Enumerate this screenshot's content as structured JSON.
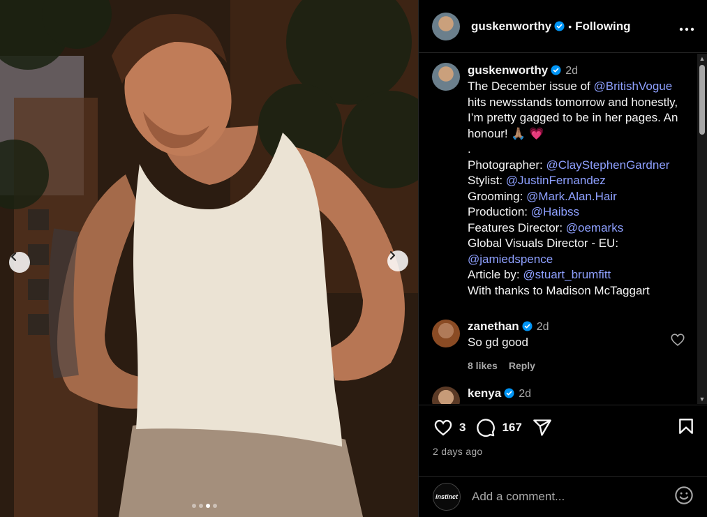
{
  "post": {
    "author": "guskenworthy",
    "follow_status": "Following",
    "separator": "•",
    "more_icon": "more-horizontal-icon",
    "carousel": {
      "total_slides": 4,
      "active_slide": 3
    }
  },
  "caption": {
    "username": "guskenworthy",
    "time": "2d",
    "lines": [
      {
        "text": "The December issue of ",
        "mention": "@BritishVogue",
        "after": " hits newsstands tomorrow and honestly, I’m pretty gagged to be in her pages. An honour! 🙏🏽 💗"
      },
      {
        "text": ".",
        "mention": "",
        "after": ""
      },
      {
        "text": "Photographer: ",
        "mention": "@ClayStephenGardner",
        "after": ""
      },
      {
        "text": "Stylist: ",
        "mention": "@JustinFernandez",
        "after": ""
      },
      {
        "text": "Grooming: ",
        "mention": "@Mark.Alan.Hair",
        "after": ""
      },
      {
        "text": "Production: ",
        "mention": "@Haibss",
        "after": ""
      },
      {
        "text": "Features Director: ",
        "mention": "@oemarks",
        "after": ""
      },
      {
        "text": "Global Visuals Director - EU: ",
        "mention": "@jamiedspence",
        "after": ""
      },
      {
        "text": "Article by: ",
        "mention": "@stuart_brumfitt",
        "after": ""
      },
      {
        "text": "With thanks to Madison McTaggart",
        "mention": "",
        "after": ""
      }
    ]
  },
  "comments": [
    {
      "username": "zanethan",
      "time": "2d",
      "text": "So gd good",
      "likes": "8 likes",
      "reply": "Reply"
    },
    {
      "username": "kenya",
      "time": "2d",
      "text": "",
      "likes": "",
      "reply": ""
    }
  ],
  "actions": {
    "like_count": "3",
    "comment_count": "167",
    "posted": "2 days ago"
  },
  "add_comment": {
    "avatar_text": "instinct",
    "placeholder": "Add a comment..."
  },
  "colors": {
    "mention": "#8ea0ff",
    "verified": "#0095f6",
    "background": "#000000",
    "muted": "#a8a8a8"
  }
}
